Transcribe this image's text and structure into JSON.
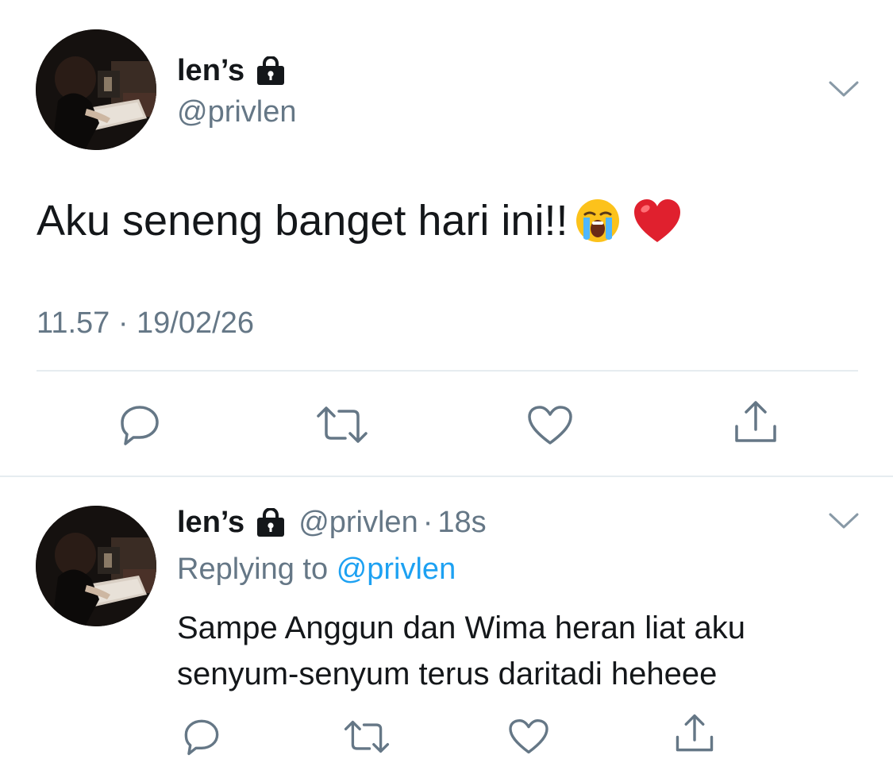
{
  "tweet": {
    "display_name": "len’s",
    "handle": "@privlen",
    "text": "Aku seneng banget hari ini!!",
    "emojis": [
      "loudly-crying-face-icon",
      "red-heart-icon"
    ],
    "timestamp": "11.57 · 19/02/26"
  },
  "actions": [
    "reply-icon",
    "retweet-icon",
    "like-icon",
    "share-icon"
  ],
  "reply": {
    "display_name": "len’s",
    "handle": "@privlen",
    "separator": "·",
    "time": "18s",
    "replying_prefix": "Replying to",
    "replying_mention": "@privlen",
    "text": "Sampe Anggun dan Wima heran liat aku senyum-senyum terus daritadi heheee"
  },
  "colors": {
    "text": "#14171a",
    "secondary": "#657786",
    "link": "#1da1f2",
    "divider": "#e6ecf0",
    "icon": "#657786"
  }
}
